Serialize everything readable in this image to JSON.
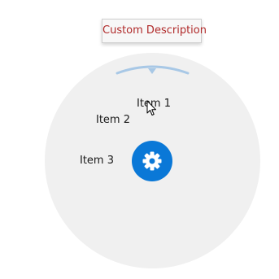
{
  "tooltip": {
    "text": "Custom Description"
  },
  "radial_menu": {
    "items": [
      {
        "label": "Item 1"
      },
      {
        "label": "Item 2"
      },
      {
        "label": "Item 3"
      }
    ],
    "center_icon": "gear-icon"
  },
  "colors": {
    "tooltip_text": "#b02a2a",
    "menu_background": "#f0f0f0",
    "arc": "#a8c8e6",
    "center_button": "#0a78d7"
  }
}
